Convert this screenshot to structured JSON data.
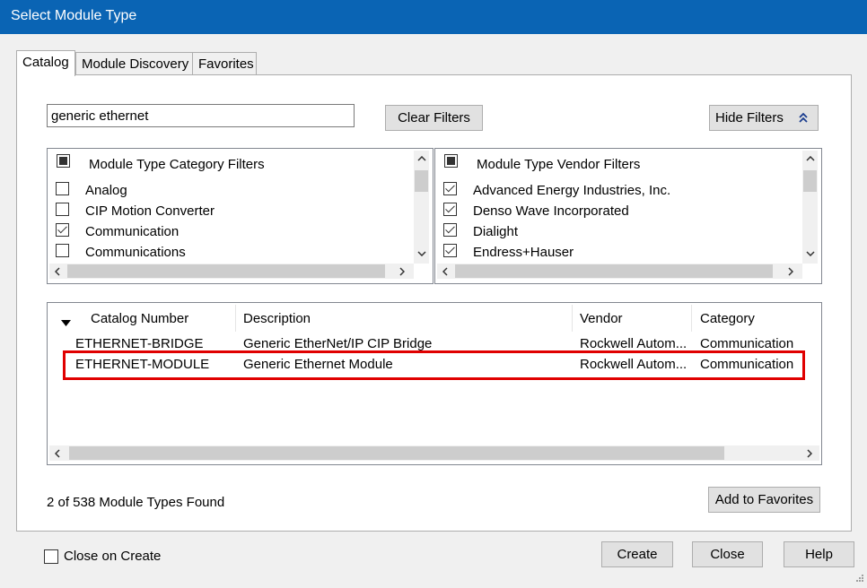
{
  "window": {
    "title": "Select Module Type"
  },
  "tabs": [
    "Catalog",
    "Module Discovery",
    "Favorites"
  ],
  "search": {
    "value": "generic ethernet",
    "placeholder": ""
  },
  "buttons": {
    "clear_filters": "Clear Filters",
    "hide_filters": "Hide Filters",
    "add_to_favorites": "Add to Favorites",
    "create": "Create",
    "close": "Close",
    "help": "Help"
  },
  "category_filters": {
    "header": "Module Type Category Filters",
    "items": [
      {
        "label": "Analog",
        "checked": false
      },
      {
        "label": "CIP Motion Converter",
        "checked": false
      },
      {
        "label": "Communication",
        "checked": true
      },
      {
        "label": "Communications",
        "checked": false
      }
    ]
  },
  "vendor_filters": {
    "header": "Module Type Vendor Filters",
    "items": [
      {
        "label": "Advanced Energy Industries, Inc.",
        "checked": true
      },
      {
        "label": "Denso Wave Incorporated",
        "checked": true
      },
      {
        "label": "Dialight",
        "checked": true
      },
      {
        "label": "Endress+Hauser",
        "checked": true
      }
    ]
  },
  "results": {
    "columns": [
      "Catalog Number",
      "Description",
      "Vendor",
      "Category"
    ],
    "rows": [
      [
        "ETHERNET-BRIDGE",
        "Generic EtherNet/IP CIP Bridge",
        "Rockwell Autom...",
        "Communication"
      ],
      [
        "ETHERNET-MODULE",
        "Generic Ethernet Module",
        "Rockwell Autom...",
        "Communication"
      ]
    ]
  },
  "status": {
    "found_text": "2 of 538 Module Types Found"
  },
  "options": {
    "close_on_create_label": "Close on Create",
    "close_on_create_checked": false
  },
  "colors": {
    "title_bar": "#0a64b4",
    "highlight": "#e00000"
  }
}
